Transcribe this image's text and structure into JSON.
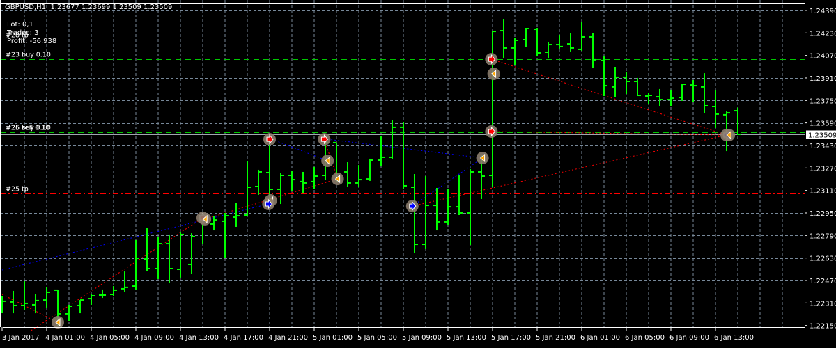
{
  "header": {
    "symbol_label": "GBPUSD,H1",
    "ohlc_label": "1.23677 1.23699 1.23509 1.23509"
  },
  "info": {
    "lot": "Lot: 0,1",
    "trades": "Trades: 3",
    "profit": "Profit: -56.938"
  },
  "colors": {
    "background": "#000000",
    "bars": "#00ff00",
    "grid": "#778899",
    "sell": "#ff0000",
    "buy": "#0000ff",
    "close": "#ffa500",
    "bid_line": "#a0a8b0"
  },
  "chart_data": {
    "type": "ohlc",
    "symbol": "GBPUSD",
    "timeframe": "H1",
    "ylim": [
      1.2215,
      1.2439
    ],
    "y_ticks": [
      "1.24390",
      "1.24230",
      "1.24070",
      "1.23910",
      "1.23750",
      "1.23590",
      "1.23430",
      "1.23270",
      "1.23110",
      "1.22950",
      "1.22790",
      "1.22630",
      "1.22470",
      "1.22310",
      "1.22150"
    ],
    "current_price": "1.23509",
    "x_labels": [
      "3 Jan 2017",
      "4 Jan 01:00",
      "4 Jan 05:00",
      "4 Jan 09:00",
      "4 Jan 13:00",
      "4 Jan 17:00",
      "4 Jan 21:00",
      "5 Jan 01:00",
      "5 Jan 05:00",
      "5 Jan 09:00",
      "5 Jan 13:00",
      "5 Jan 17:00",
      "5 Jan 21:00",
      "6 Jan 01:00",
      "6 Jan 05:00",
      "6 Jan 09:00",
      "6 Jan 13:00"
    ],
    "x_label_bar_step": 4,
    "ohlc": [
      [
        1.22336,
        1.22361,
        1.22247,
        1.22322
      ],
      [
        1.22317,
        1.22396,
        1.22242,
        1.22292
      ],
      [
        1.22292,
        1.22465,
        1.22267,
        1.22307
      ],
      [
        1.22297,
        1.22376,
        1.22242,
        1.22327
      ],
      [
        1.22331,
        1.22421,
        1.22282,
        1.22386
      ],
      [
        1.22401,
        1.22401,
        1.22153,
        1.22233
      ],
      [
        1.22233,
        1.22297,
        1.22188,
        1.22287
      ],
      [
        1.22292,
        1.22331,
        1.22242,
        1.22331
      ],
      [
        1.22341,
        1.22376,
        1.22302,
        1.22361
      ],
      [
        1.22366,
        1.22406,
        1.22351,
        1.22366
      ],
      [
        1.22371,
        1.2243,
        1.22361,
        1.22401
      ],
      [
        1.22411,
        1.22534,
        1.22391,
        1.22421
      ],
      [
        1.2243,
        1.22757,
        1.22411,
        1.22628
      ],
      [
        1.22623,
        1.22841,
        1.22544,
        1.22554
      ],
      [
        1.22554,
        1.22782,
        1.22485,
        1.22732
      ],
      [
        1.22732,
        1.22797,
        1.22455,
        1.22554
      ],
      [
        1.22549,
        1.22811,
        1.22495,
        1.22797
      ],
      [
        1.22584,
        1.22806,
        1.22524,
        1.22782
      ],
      [
        1.2292,
        1.2294,
        1.22732,
        1.22891
      ],
      [
        1.22871,
        1.2293,
        1.22831,
        1.229
      ],
      [
        1.22891,
        1.2295,
        1.22633,
        1.2293
      ],
      [
        1.2292,
        1.23024,
        1.22856,
        1.2293
      ],
      [
        1.22935,
        1.23316,
        1.2293,
        1.23133
      ],
      [
        1.23138,
        1.23257,
        1.23084,
        1.23242
      ],
      [
        1.23237,
        1.23499,
        1.23019,
        1.23118
      ],
      [
        1.23118,
        1.23232,
        1.23019,
        1.23217
      ],
      [
        1.23217,
        1.23247,
        1.23113,
        1.23187
      ],
      [
        1.23173,
        1.23242,
        1.23093,
        1.23163
      ],
      [
        1.23173,
        1.23277,
        1.23128,
        1.23212
      ],
      [
        1.23217,
        1.2346,
        1.23192,
        1.2345
      ],
      [
        1.2345,
        1.2345,
        1.23178,
        1.23178
      ],
      [
        1.23242,
        1.23311,
        1.23143,
        1.23163
      ],
      [
        1.23163,
        1.23291,
        1.23143,
        1.23187
      ],
      [
        1.23192,
        1.23336,
        1.23183,
        1.23326
      ],
      [
        1.23326,
        1.23499,
        1.23291,
        1.23346
      ],
      [
        1.23346,
        1.23613,
        1.23336,
        1.23559
      ],
      [
        1.23559,
        1.23593,
        1.23128,
        1.23143
      ],
      [
        1.23133,
        1.23227,
        1.22668,
        1.22727
      ],
      [
        1.22727,
        1.23212,
        1.22698,
        1.23004
      ],
      [
        1.23004,
        1.23128,
        1.22831,
        1.22886
      ],
      [
        1.22886,
        1.23118,
        1.22871,
        1.22994
      ],
      [
        1.22994,
        1.23217,
        1.2294,
        1.2295
      ],
      [
        1.2295,
        1.23262,
        1.22727,
        1.23242
      ],
      [
        1.23242,
        1.23366,
        1.23054,
        1.23212
      ],
      [
        1.23217,
        1.24246,
        1.23143,
        1.24241
      ],
      [
        1.24246,
        1.2433,
        1.24053,
        1.24123
      ],
      [
        1.24123,
        1.24192,
        1.24004,
        1.24177
      ],
      [
        1.24182,
        1.24266,
        1.24133,
        1.24261
      ],
      [
        1.24256,
        1.24266,
        1.24068,
        1.24088
      ],
      [
        1.24093,
        1.24167,
        1.24053,
        1.24147
      ],
      [
        1.24147,
        1.24212,
        1.24123,
        1.24133
      ],
      [
        1.24152,
        1.24227,
        1.24103,
        1.24123
      ],
      [
        1.24113,
        1.24306,
        1.24108,
        1.24202
      ],
      [
        1.24202,
        1.24231,
        1.23984,
        1.24039
      ],
      [
        1.24034,
        1.24063,
        1.23786,
        1.23855
      ],
      [
        1.23846,
        1.23989,
        1.23781,
        1.23915
      ],
      [
        1.23915,
        1.23954,
        1.23801,
        1.23885
      ],
      [
        1.23885,
        1.2391,
        1.23786,
        1.23786
      ],
      [
        1.23781,
        1.23801,
        1.23727,
        1.23786
      ],
      [
        1.23776,
        1.23831,
        1.23712,
        1.23756
      ],
      [
        1.23756,
        1.23826,
        1.23712,
        1.23766
      ],
      [
        1.23771,
        1.2387,
        1.23752,
        1.23865
      ],
      [
        1.2386,
        1.23895,
        1.23742,
        1.23855
      ],
      [
        1.23846,
        1.23944,
        1.23667,
        1.23712
      ],
      [
        1.23707,
        1.23821,
        1.23559,
        1.23653
      ],
      [
        1.23648,
        1.23672,
        1.23395,
        1.23662
      ],
      [
        1.23677,
        1.23699,
        1.23509,
        1.23509
      ]
    ],
    "order_lines": [
      {
        "label": "#28 tp",
        "price": 1.24182,
        "kind": "tp"
      },
      {
        "label": "#23 buy 0.10",
        "price": 1.24043,
        "kind": "open"
      },
      {
        "label": "#26 buy 0.10",
        "price": 1.23524,
        "kind": "open"
      },
      {
        "label": "#25 sell 0.10",
        "price": 1.23524,
        "kind": "open"
      },
      {
        "label": "#25 tp",
        "price": 1.23089,
        "kind": "tp"
      }
    ],
    "trade_markers": [
      {
        "bar": 5,
        "price": 1.22173,
        "type": "close"
      },
      {
        "bar": 18,
        "price": 1.22915,
        "type": "sell"
      },
      {
        "bar": 18.2,
        "price": 1.22906,
        "type": "close"
      },
      {
        "bar": 24,
        "price": 1.23474,
        "type": "sell"
      },
      {
        "bar": 24.1,
        "price": 1.23039,
        "type": "close"
      },
      {
        "bar": 23.9,
        "price": 1.23014,
        "type": "buy"
      },
      {
        "bar": 28.9,
        "price": 1.23474,
        "type": "sell"
      },
      {
        "bar": 29.2,
        "price": 1.23321,
        "type": "close"
      },
      {
        "bar": 30.1,
        "price": 1.23192,
        "type": "close"
      },
      {
        "bar": 36.8,
        "price": 1.22999,
        "type": "buy"
      },
      {
        "bar": 43.1,
        "price": 1.23341,
        "type": "close"
      },
      {
        "bar": 43.9,
        "price": 1.24043,
        "type": "sell"
      },
      {
        "bar": 44.1,
        "price": 1.23939,
        "type": "close"
      },
      {
        "bar": 43.9,
        "price": 1.23529,
        "type": "sell"
      },
      {
        "bar": 65,
        "price": 1.23504,
        "type": "buy"
      },
      {
        "bar": 65.2,
        "price": 1.23504,
        "type": "close"
      }
    ],
    "trade_lines": [
      {
        "from": [
          0,
          1.22544
        ],
        "to": [
          23.9,
          1.23014
        ],
        "side": "buy"
      },
      {
        "from": [
          24.2,
          1.23474
        ],
        "to": [
          29.2,
          1.23321
        ],
        "side": "buy"
      },
      {
        "from": [
          29.2,
          1.23474
        ],
        "to": [
          43.1,
          1.23341
        ],
        "side": "buy"
      },
      {
        "from": [
          36.8,
          1.22999
        ],
        "to": [
          43.1,
          1.23341
        ],
        "side": "buy"
      },
      {
        "from": [
          0,
          1.22371
        ],
        "to": [
          5,
          1.22173
        ],
        "side": "sell"
      },
      {
        "from": [
          2.6,
          1.22114
        ],
        "to": [
          18,
          1.22915
        ],
        "side": "sell"
      },
      {
        "from": [
          18.2,
          1.22906
        ],
        "to": [
          30.1,
          1.23192
        ],
        "side": "sell"
      },
      {
        "from": [
          28.9,
          1.23474
        ],
        "to": [
          30.1,
          1.23192
        ],
        "side": "sell"
      },
      {
        "from": [
          36.8,
          1.22999
        ],
        "to": [
          65,
          1.23504
        ],
        "side": "sell"
      },
      {
        "from": [
          43.9,
          1.24043
        ],
        "to": [
          65,
          1.23504
        ],
        "side": "sell"
      },
      {
        "from": [
          43.9,
          1.23529
        ],
        "to": [
          65,
          1.23504
        ],
        "side": "sell"
      }
    ]
  }
}
